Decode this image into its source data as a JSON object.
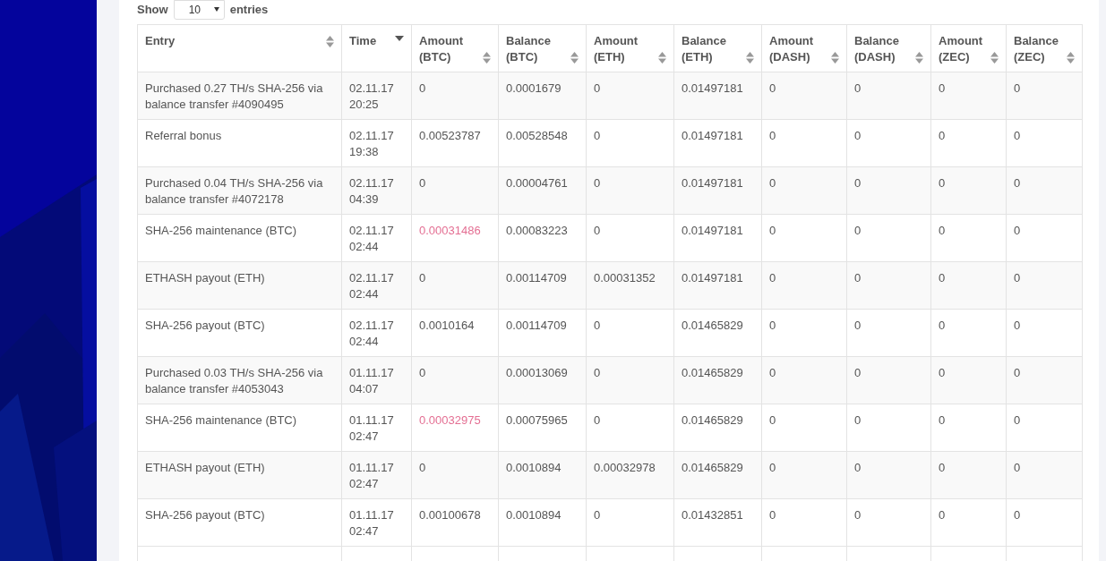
{
  "length_control": {
    "before": "Show",
    "value": "10",
    "after": "entries"
  },
  "table": {
    "columns": [
      {
        "label": "Entry",
        "sorted": false
      },
      {
        "label": "Time",
        "sorted": true
      },
      {
        "label": "Amount (BTC)",
        "sorted": false
      },
      {
        "label": "Balance (BTC)",
        "sorted": false
      },
      {
        "label": "Amount (ETH)",
        "sorted": false
      },
      {
        "label": "Balance (ETH)",
        "sorted": false
      },
      {
        "label": "Amount (DASH)",
        "sorted": false
      },
      {
        "label": "Balance (DASH)",
        "sorted": false
      },
      {
        "label": "Amount (ZEC)",
        "sorted": false
      },
      {
        "label": "Balance (ZEC)",
        "sorted": false
      }
    ],
    "rows": [
      {
        "btc_amount_debit": false,
        "cells": [
          "Purchased 0.27 TH/s SHA-256 via balance transfer #4090495",
          "02.11.17 20:25",
          "0",
          "0.0001679",
          "0",
          "0.01497181",
          "0",
          "0",
          "0",
          "0"
        ]
      },
      {
        "btc_amount_debit": false,
        "cells": [
          "Referral bonus",
          "02.11.17 19:38",
          "0.00523787",
          "0.00528548",
          "0",
          "0.01497181",
          "0",
          "0",
          "0",
          "0"
        ]
      },
      {
        "btc_amount_debit": false,
        "cells": [
          "Purchased 0.04 TH/s SHA-256 via balance transfer #4072178",
          "02.11.17 04:39",
          "0",
          "0.00004761",
          "0",
          "0.01497181",
          "0",
          "0",
          "0",
          "0"
        ]
      },
      {
        "btc_amount_debit": true,
        "cells": [
          "SHA-256 maintenance (BTC)",
          "02.11.17 02:44",
          "0.00031486",
          "0.00083223",
          "0",
          "0.01497181",
          "0",
          "0",
          "0",
          "0"
        ]
      },
      {
        "btc_amount_debit": false,
        "cells": [
          "ETHASH payout (ETH)",
          "02.11.17 02:44",
          "0",
          "0.00114709",
          "0.00031352",
          "0.01497181",
          "0",
          "0",
          "0",
          "0"
        ]
      },
      {
        "btc_amount_debit": false,
        "cells": [
          "SHA-256 payout (BTC)",
          "02.11.17 02:44",
          "0.0010164",
          "0.00114709",
          "0",
          "0.01465829",
          "0",
          "0",
          "0",
          "0"
        ]
      },
      {
        "btc_amount_debit": false,
        "cells": [
          "Purchased 0.03 TH/s SHA-256 via balance transfer #4053043",
          "01.11.17 04:07",
          "0",
          "0.00013069",
          "0",
          "0.01465829",
          "0",
          "0",
          "0",
          "0"
        ]
      },
      {
        "btc_amount_debit": true,
        "cells": [
          "SHA-256 maintenance (BTC)",
          "01.11.17 02:47",
          "0.00032975",
          "0.00075965",
          "0",
          "0.01465829",
          "0",
          "0",
          "0",
          "0"
        ]
      },
      {
        "btc_amount_debit": false,
        "cells": [
          "ETHASH payout (ETH)",
          "01.11.17 02:47",
          "0",
          "0.0010894",
          "0.00032978",
          "0.01465829",
          "0",
          "0",
          "0",
          "0"
        ]
      },
      {
        "btc_amount_debit": false,
        "cells": [
          "SHA-256 payout (BTC)",
          "01.11.17 02:47",
          "0.00100678",
          "0.0010894",
          "0",
          "0.01432851",
          "0",
          "0",
          "0",
          "0"
        ]
      }
    ]
  }
}
